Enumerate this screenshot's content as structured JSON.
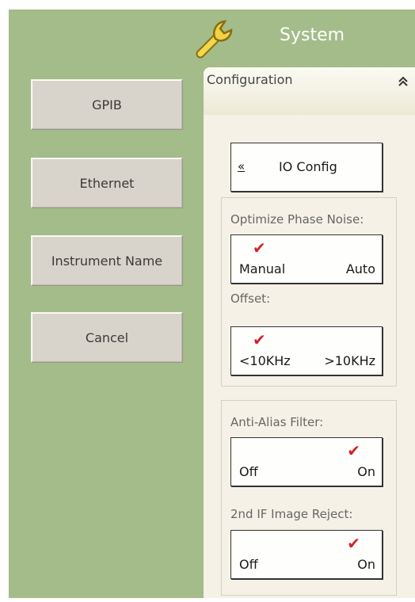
{
  "header": {
    "title": "System",
    "icon": "wrench-icon"
  },
  "left_menu": [
    {
      "label": "GPIB"
    },
    {
      "label": "Ethernet"
    },
    {
      "label": "Instrument Name"
    },
    {
      "label": "Cancel"
    }
  ],
  "panel": {
    "title": "Configuration",
    "io_config": {
      "arrow": "«",
      "label": "IO Config"
    },
    "phase_noise": {
      "label": "Optimize Phase Noise:",
      "left": "Manual",
      "right": "Auto",
      "selected": "Manual"
    },
    "offset": {
      "label": "Offset:",
      "left": "<10KHz",
      "right": ">10KHz",
      "selected": "<10KHz"
    },
    "anti_alias": {
      "label": "Anti-Alias Filter:",
      "left": "Off",
      "right": "On",
      "selected": "On"
    },
    "if_reject": {
      "label": "2nd IF Image Reject:",
      "left": "Off",
      "right": "On",
      "selected": "On"
    }
  },
  "colors": {
    "background": "#a3bc8a",
    "check": "#d2232a",
    "panel": "#f5f1e6"
  }
}
